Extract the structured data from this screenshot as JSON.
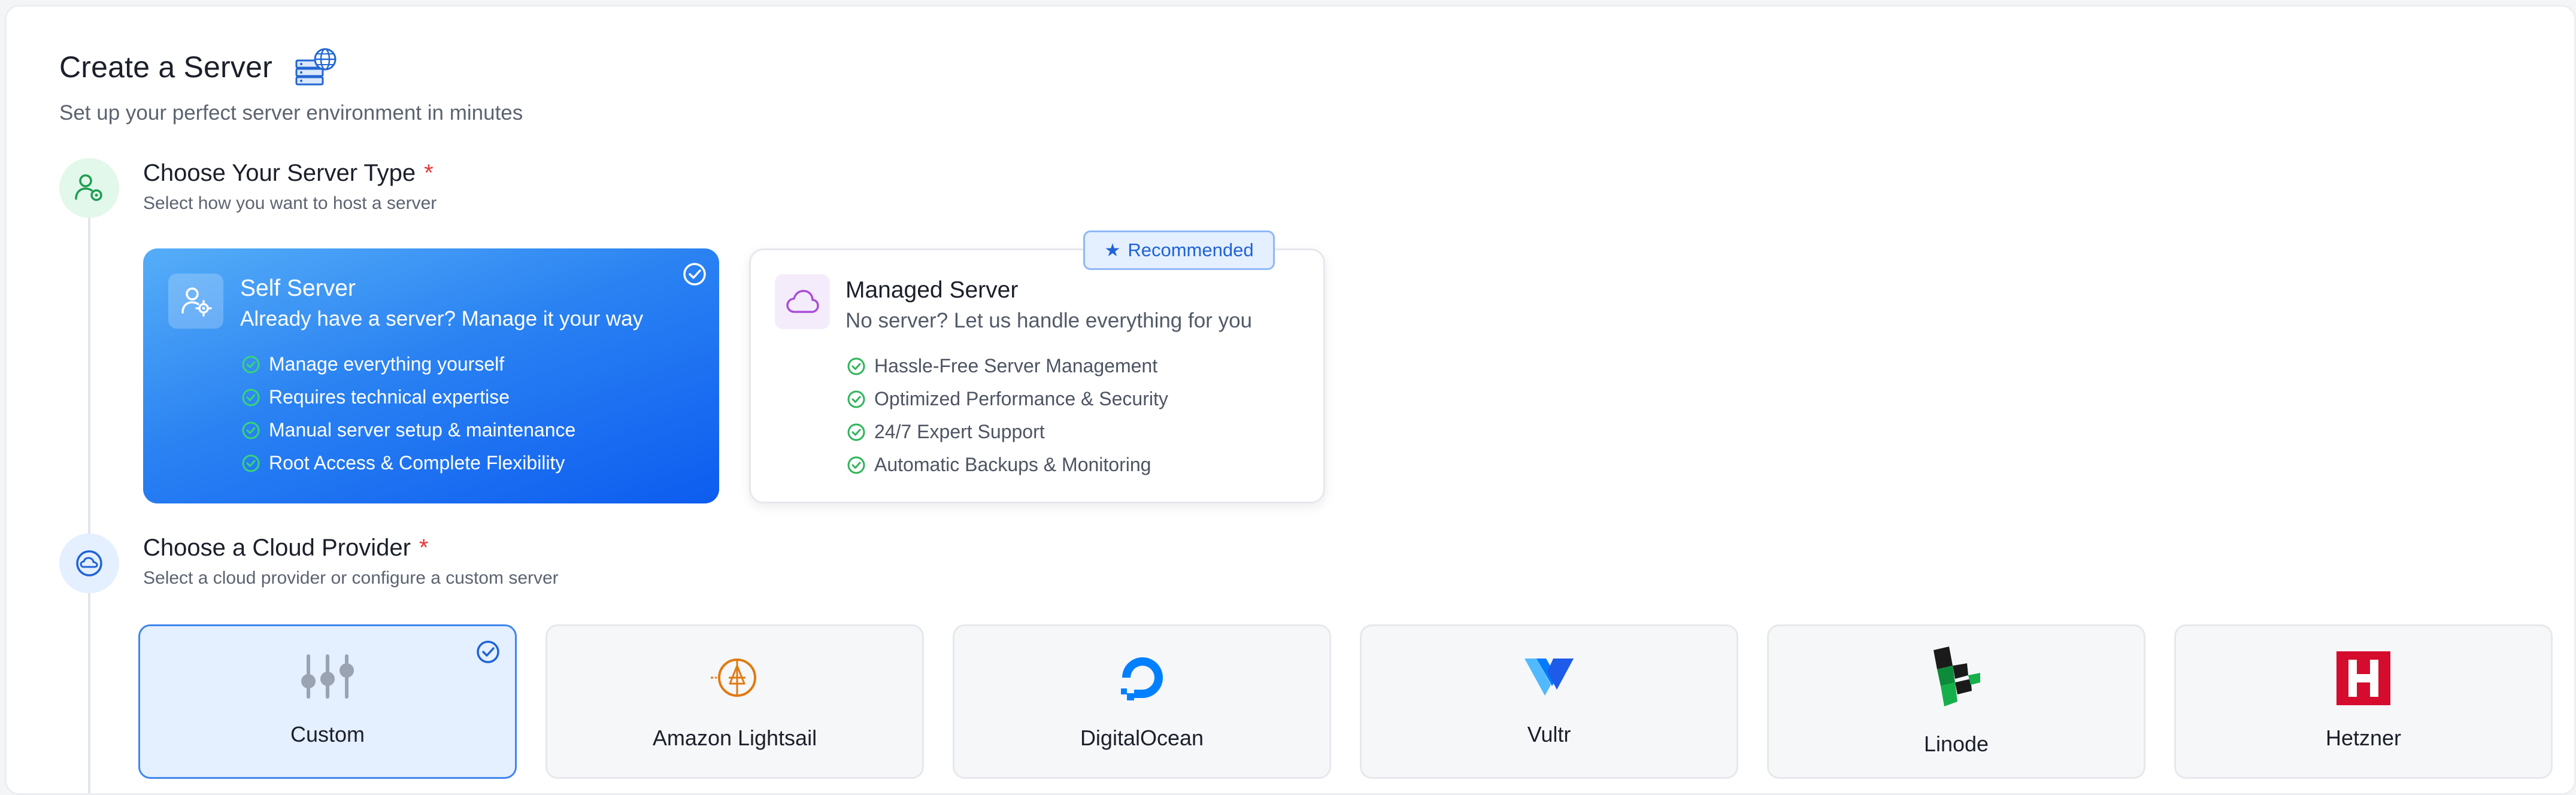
{
  "header": {
    "title": "Create a Server",
    "subtitle": "Set up your perfect server environment in minutes"
  },
  "server_type": {
    "title": "Choose Your Server Type",
    "required_mark": "*",
    "description": "Select how you want to host a server",
    "cards": [
      {
        "title": "Self Server",
        "tagline": "Already have a server? Manage it your way",
        "selected": true,
        "features": [
          "Manage everything yourself",
          "Requires technical expertise",
          "Manual server setup & maintenance",
          "Root Access & Complete Flexibility"
        ]
      },
      {
        "title": "Managed Server",
        "tagline": "No server? Let us handle everything for you",
        "selected": false,
        "badge": "Recommended",
        "features": [
          "Hassle-Free Server Management",
          "Optimized Performance & Security",
          "24/7 Expert Support",
          "Automatic Backups & Monitoring"
        ]
      }
    ]
  },
  "cloud_provider": {
    "title": "Choose a Cloud Provider",
    "required_mark": "*",
    "description": "Select a cloud provider or configure a custom server",
    "providers": [
      {
        "label": "Custom",
        "icon": "sliders-icon",
        "selected": true
      },
      {
        "label": "Amazon Lightsail",
        "icon": "lightsail-logo",
        "selected": false
      },
      {
        "label": "DigitalOcean",
        "icon": "digitalocean-logo",
        "selected": false
      },
      {
        "label": "Vultr",
        "icon": "vultr-logo",
        "selected": false
      },
      {
        "label": "Linode",
        "icon": "linode-logo",
        "selected": false
      },
      {
        "label": "Hetzner",
        "icon": "hetzner-logo",
        "selected": false
      }
    ]
  },
  "colors": {
    "accent": "#1f63d6",
    "selected_gradient_start": "#56aef8",
    "selected_gradient_end": "#0d5cf0",
    "success": "#2fb55a",
    "required": "#e53935"
  }
}
